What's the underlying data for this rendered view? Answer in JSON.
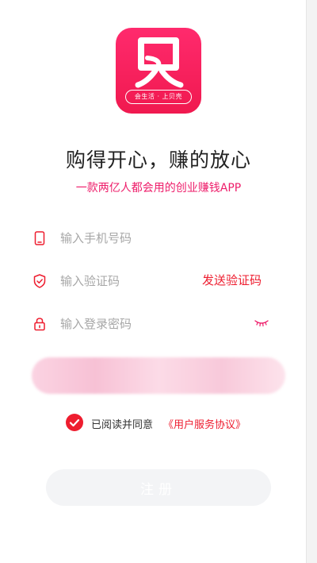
{
  "app": {
    "logo_tag": "会生活 · 上贝壳",
    "title": "购得开心，赚的放心",
    "subtitle": "一款两亿人都会用的创业赚钱APP"
  },
  "form": {
    "phone_placeholder": "输入手机号码",
    "code_placeholder": "输入验证码",
    "send_code_label": "发送验证码",
    "password_placeholder": "输入登录密码"
  },
  "agreement": {
    "checked": true,
    "text": "已阅读并同意",
    "link": "《用户服务协议》"
  },
  "register_label": "注册",
  "colors": {
    "accent": "#ee1d2f",
    "brand_pink": "#ff2a6d",
    "subtitle": "#ee1d6a",
    "register_bg": "#f3f4f6"
  },
  "icons": {
    "phone": "phone-icon",
    "shield": "shield-icon",
    "lock": "lock-icon",
    "eye": "eye-closed-icon",
    "check": "check-icon"
  }
}
